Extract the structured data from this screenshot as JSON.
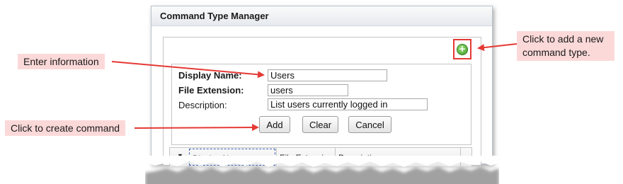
{
  "window": {
    "title": "Command Type Manager"
  },
  "form": {
    "display_name_label": "Display Name:",
    "display_name_value": "Users",
    "file_extension_label": "File Extension:",
    "file_extension_value": "users",
    "description_label": "Description:",
    "description_value": "List users currently logged in"
  },
  "buttons": {
    "add": "Add",
    "clear": "Clear",
    "cancel": "Cancel",
    "add_type_icon": "+"
  },
  "grid": {
    "columns": [
      "Display Name",
      "File Extension",
      "Description"
    ]
  },
  "callouts": {
    "enter_info": "Enter information",
    "create_command": "Click to create command",
    "add_new_line1": "Click to add a new",
    "add_new_line2": "command type."
  },
  "colors": {
    "callout_bg": "#fcd9d9",
    "arrow": "#e53935",
    "add_icon": "#3d9a27"
  },
  "icons": {
    "add_type": "plus-circle-icon",
    "sort": "sort-arrow-icon"
  }
}
